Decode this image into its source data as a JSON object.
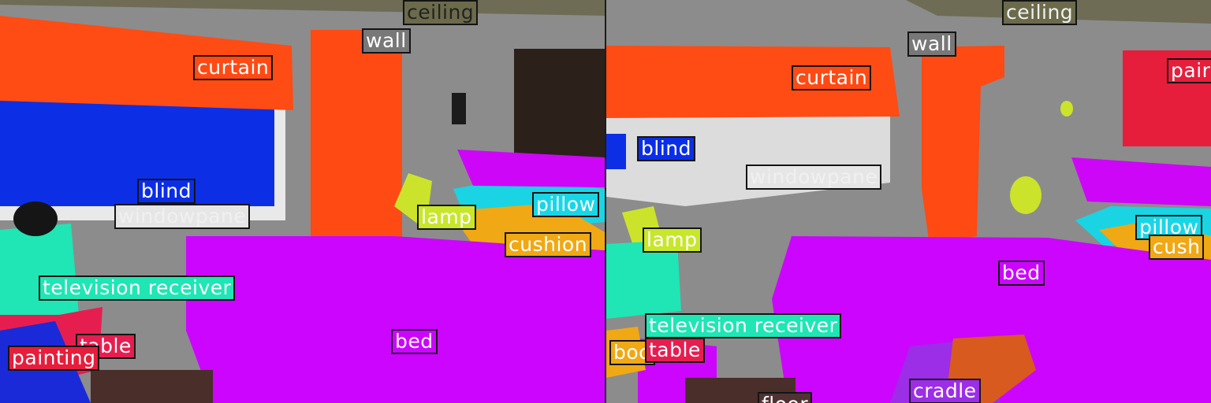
{
  "views": [
    {
      "name": "left",
      "labels": [
        {
          "text": "ceiling",
          "color": "#6b6b4c"
        },
        {
          "text": "wall",
          "color": "#787878"
        },
        {
          "text": "curtain",
          "color": "#ff4a14"
        },
        {
          "text": "blind",
          "color": "#0a2ee8"
        },
        {
          "text": "windowpane",
          "color": "#e6e6e6"
        },
        {
          "text": "lamp",
          "color": "#c8e62a"
        },
        {
          "text": "pillow",
          "color": "#19d6e6"
        },
        {
          "text": "cushion",
          "color": "#f0a814"
        },
        {
          "text": "television receiver",
          "color": "#1fe6b4"
        },
        {
          "text": "table",
          "color": "#e61e50"
        },
        {
          "text": "painting",
          "color": "#e61e3c"
        },
        {
          "text": "bed",
          "color": "#cc05ff"
        }
      ]
    },
    {
      "name": "right",
      "labels": [
        {
          "text": "ceiling",
          "color": "#6b6b4c"
        },
        {
          "text": "wall",
          "color": "#787878"
        },
        {
          "text": "curtain",
          "color": "#ff4a14"
        },
        {
          "text": "pair",
          "color": "#e61e3c"
        },
        {
          "text": "blind",
          "color": "#0a2ee8"
        },
        {
          "text": "windowpane",
          "color": "#e6e6e6"
        },
        {
          "text": "lamp",
          "color": "#c8e62a"
        },
        {
          "text": "pillow",
          "color": "#19d6e6"
        },
        {
          "text": "cush",
          "color": "#f0a814"
        },
        {
          "text": "bed",
          "color": "#cc05ff"
        },
        {
          "text": "television receiver",
          "color": "#1fe6b4"
        },
        {
          "text": "boo",
          "color": "#f0a814"
        },
        {
          "text": "table",
          "color": "#e61e50"
        },
        {
          "text": "cradle",
          "color": "#9b2ee6"
        },
        {
          "text": "floor",
          "color": "#503232"
        }
      ]
    }
  ]
}
